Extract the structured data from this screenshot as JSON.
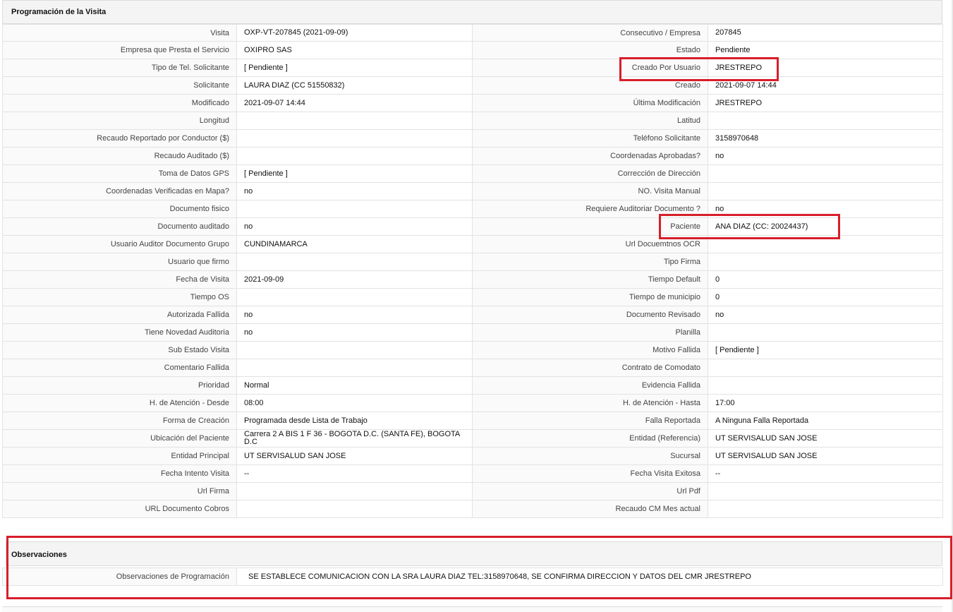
{
  "section": {
    "title": "Programación de la Visita",
    "rows": [
      [
        {
          "label": "Visita",
          "value": "OXP-VT-207845 (2021-09-09)"
        },
        {
          "label": "Consecutivo / Empresa",
          "value": "207845"
        }
      ],
      [
        {
          "label": "Empresa que Presta el Servicio",
          "value": "OXIPRO SAS"
        },
        {
          "label": "Estado",
          "value": "Pendiente"
        }
      ],
      [
        {
          "label": "Tipo de Tel. Solicitante",
          "value": "[ Pendiente ]"
        },
        {
          "label": "Creado Por Usuario",
          "value": "JRESTREPO"
        }
      ],
      [
        {
          "label": "Solicitante",
          "value": "LAURA DIAZ (CC 51550832)"
        },
        {
          "label": "Creado",
          "value": "2021-09-07 14:44"
        }
      ],
      [
        {
          "label": "Modificado",
          "value": "2021-09-07 14:44"
        },
        {
          "label": "Última Modificación",
          "value": " JRESTREPO"
        }
      ],
      [
        {
          "label": "Longitud",
          "value": ""
        },
        {
          "label": "Latitud",
          "value": ""
        }
      ],
      [
        {
          "label": "Recaudo Reportado por Conductor ($)",
          "value": ""
        },
        {
          "label": "Teléfono Solicitante",
          "value": "3158970648"
        }
      ],
      [
        {
          "label": "Recaudo Auditado ($)",
          "value": ""
        },
        {
          "label": "Coordenadas Aprobadas?",
          "value": " no"
        }
      ],
      [
        {
          "label": "Toma de Datos GPS",
          "value": "[ Pendiente ]"
        },
        {
          "label": "Corrección de Dirección",
          "value": ""
        }
      ],
      [
        {
          "label": "Coordenadas Verificadas en Mapa?",
          "value": " no"
        },
        {
          "label": "NO. Visita Manual",
          "value": ""
        }
      ],
      [
        {
          "label": "Documento fisico",
          "value": ""
        },
        {
          "label": "Requiere Auditoriar Documento ?",
          "value": " no"
        }
      ],
      [
        {
          "label": "Documento auditado",
          "value": " no"
        },
        {
          "label": "Paciente",
          "value": "ANA DIAZ (CC: 20024437)"
        }
      ],
      [
        {
          "label": "Usuario Auditor Documento Grupo",
          "value": "CUNDINAMARCA"
        },
        {
          "label": "Url Docuemtnos OCR",
          "value": ""
        }
      ],
      [
        {
          "label": "Usuario que firmo",
          "value": ""
        },
        {
          "label": "Tipo Firma",
          "value": ""
        }
      ],
      [
        {
          "label": "Fecha de Visita",
          "value": " 2021-09-09"
        },
        {
          "label": "Tiempo Default",
          "value": "0"
        }
      ],
      [
        {
          "label": "Tiempo OS",
          "value": ""
        },
        {
          "label": "Tiempo de municipio",
          "value": "0"
        }
      ],
      [
        {
          "label": "Autorizada Fallida",
          "value": " no"
        },
        {
          "label": "Documento Revisado",
          "value": " no"
        }
      ],
      [
        {
          "label": "Tiene Novedad Auditoria",
          "value": " no"
        },
        {
          "label": "Planilla",
          "value": ""
        }
      ],
      [
        {
          "label": "Sub Estado Visita",
          "value": ""
        },
        {
          "label": "Motivo Fallida",
          "value": "[ Pendiente ]"
        }
      ],
      [
        {
          "label": "Comentario Fallida",
          "value": ""
        },
        {
          "label": "Contrato de Comodato",
          "value": ""
        }
      ],
      [
        {
          "label": "Prioridad",
          "value": "Normal"
        },
        {
          "label": "Evidencia Fallida",
          "value": ""
        }
      ],
      [
        {
          "label": "H. de Atención - Desde",
          "value": "08:00"
        },
        {
          "label": "H. de Atención - Hasta",
          "value": "17:00"
        }
      ],
      [
        {
          "label": "Forma de Creación",
          "value": "Programada desde Lista de Trabajo"
        },
        {
          "label": "Falla Reportada",
          "value": "A Ninguna Falla Reportada"
        }
      ],
      [
        {
          "label": "Ubicación del Paciente",
          "value": "Carrera 2 A BIS 1 F 36 - BOGOTA D.C. (SANTA FE), BOGOTA D.C"
        },
        {
          "label": "Entidad (Referencia)",
          "value": "UT SERVISALUD SAN JOSE"
        }
      ],
      [
        {
          "label": "Entidad Principal",
          "value": "UT SERVISALUD SAN JOSE"
        },
        {
          "label": "Sucursal",
          "value": "UT SERVISALUD SAN JOSE"
        }
      ],
      [
        {
          "label": "Fecha Intento Visita",
          "value": " --"
        },
        {
          "label": "Fecha Visita Exitosa",
          "value": " --"
        }
      ],
      [
        {
          "label": "Url Firma",
          "value": ""
        },
        {
          "label": "Url Pdf",
          "value": ""
        }
      ],
      [
        {
          "label": "URL Documento Cobros",
          "value": ""
        },
        {
          "label": "Recaudo CM Mes actual",
          "value": ""
        }
      ]
    ]
  },
  "observaciones": {
    "title": "Observaciones",
    "label": "Observaciones de Programación",
    "value": "SE ESTABLECE COMUNICACION CON LA SRA LAURA DIAZ TEL:3158970648, SE CONFIRMA DIRECCION Y DATOS DEL CMR JRESTREPO"
  },
  "highlight_color": "#d81e2a"
}
